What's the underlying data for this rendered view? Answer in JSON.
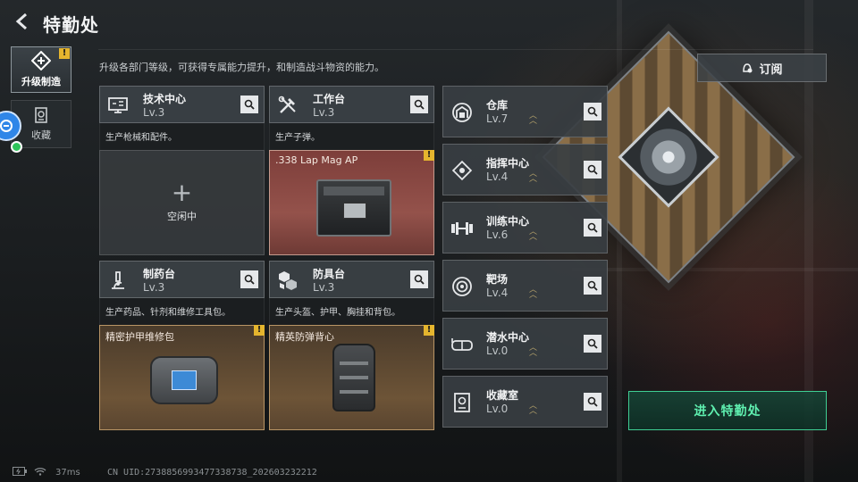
{
  "header": {
    "title": "特勤处"
  },
  "nav": {
    "items": [
      {
        "label": "升级制造",
        "active": true,
        "badge": "!"
      },
      {
        "label": "收藏",
        "active": false
      }
    ]
  },
  "subtitle": "升级各部门等级，可获得专属能力提升，和制造战斗物资的能力。",
  "subscribe": {
    "label": "订阅"
  },
  "stations": [
    {
      "name": "技术中心",
      "level": "Lv.3",
      "desc": "生产枪械和配件。",
      "slot": {
        "state": "idle",
        "plus": "+",
        "label": "空闲中"
      }
    },
    {
      "name": "工作台",
      "level": "Lv.3",
      "desc": "生产子弹。",
      "slot": {
        "state": "crafting",
        "item": ".338 Lap Mag AP",
        "badge": "!"
      }
    },
    {
      "name": "制药台",
      "level": "Lv.3",
      "desc": "生产药品、针剂和维修工具包。",
      "slot": {
        "state": "crafting",
        "item": "精密护甲维修包",
        "badge": "!"
      }
    },
    {
      "name": "防具台",
      "level": "Lv.3",
      "desc": "生产头盔、护甲、胸挂和背包。",
      "slot": {
        "state": "crafting",
        "item": "精英防弹背心",
        "badge": "!"
      }
    }
  ],
  "facilities": [
    {
      "name": "仓库",
      "level": "Lv.7",
      "icon": "warehouse-icon"
    },
    {
      "name": "指挥中心",
      "level": "Lv.4",
      "icon": "command-center-icon"
    },
    {
      "name": "训练中心",
      "level": "Lv.6",
      "icon": "dumbbell-icon"
    },
    {
      "name": "靶场",
      "level": "Lv.4",
      "icon": "target-icon"
    },
    {
      "name": "潜水中心",
      "level": "Lv.0",
      "icon": "diving-mask-icon"
    },
    {
      "name": "收藏室",
      "level": "Lv.0",
      "icon": "collection-room-icon"
    }
  ],
  "enter_button": {
    "label": "进入特勤处"
  },
  "footer": {
    "ping": "37ms",
    "uid": "CN UID:2738856993477338738_202603232212"
  },
  "colors": {
    "accent_green": "#3fcf94",
    "warning_yellow": "#e5b52e",
    "crafting_red": "#94524b",
    "crafting_gold": "#6d5437"
  }
}
